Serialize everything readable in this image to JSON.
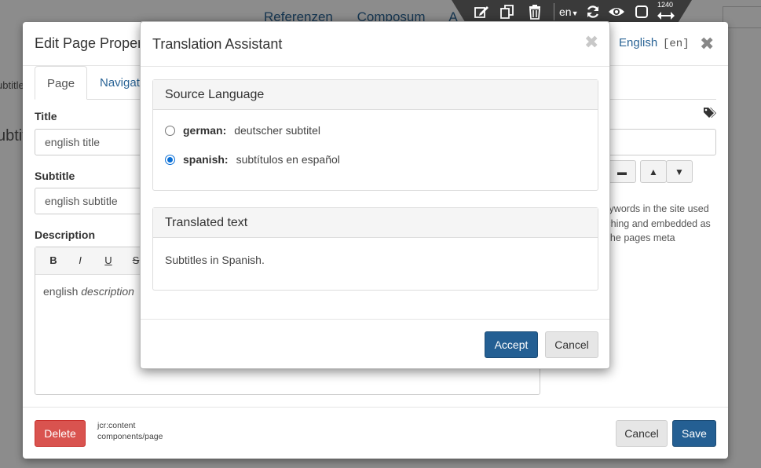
{
  "background": {
    "nav_items": [
      "Referenzen",
      "Composum",
      "A"
    ],
    "left_label": "ubtitle",
    "left_big": "ubtitle"
  },
  "toolbar": {
    "icons": [
      "edit-icon",
      "copy-icon",
      "trash-icon",
      "refresh-icon",
      "eye-icon",
      "square-icon",
      "width-arrows-icon"
    ],
    "language": "en",
    "width_value": "1240"
  },
  "edit_dialog": {
    "title": "Edit Page Properties",
    "language_name": "English",
    "language_code": "[en]",
    "tabs": [
      {
        "label": "Page",
        "active": true
      },
      {
        "label": "Navigation",
        "active": false
      }
    ],
    "fields": {
      "title_label": "Title",
      "title_value": "english title",
      "subtitle_label": "Subtitle",
      "subtitle_value": "english subtitle",
      "description_label": "Description",
      "description_plain": "english ",
      "description_italic": "description"
    },
    "rte_buttons": [
      "B",
      "I",
      "U",
      "S"
    ],
    "keywords_help": "Short keywords in the site used for searching and embedded as meta in the pages meta",
    "footer": {
      "delete_label": "Delete",
      "path_line1": "jcr:content",
      "path_line2": "components/page",
      "cancel_label": "Cancel",
      "save_label": "Save"
    }
  },
  "translation_assistant": {
    "title": "Translation Assistant",
    "source_panel": {
      "heading": "Source Language",
      "options": [
        {
          "language": "german:",
          "text": "deutscher subtitel",
          "selected": false
        },
        {
          "language": "spanish:",
          "text": "subtítulos en español",
          "selected": true
        }
      ]
    },
    "translated_panel": {
      "heading": "Translated text",
      "text": "Subtitles in Spanish."
    },
    "accept_label": "Accept",
    "cancel_label": "Cancel"
  },
  "colors": {
    "primary": "#245f93",
    "danger": "#d9534f",
    "link": "#2a6496",
    "toolbar": "#3a3a3a"
  }
}
